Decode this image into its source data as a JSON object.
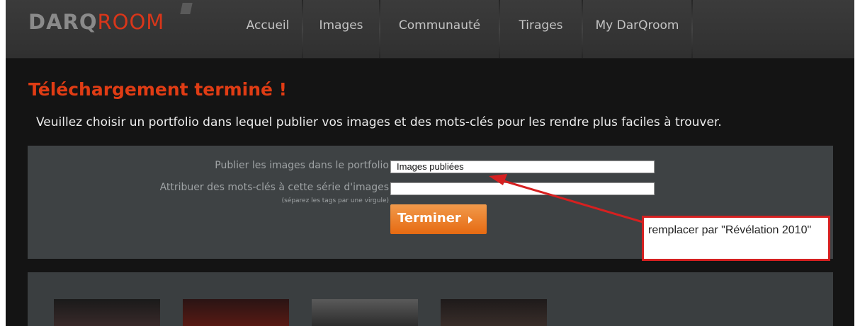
{
  "brand": {
    "part1": "DARQ",
    "part2": "ROOM"
  },
  "nav": {
    "items": [
      {
        "label": "Accueil"
      },
      {
        "label": "Images"
      },
      {
        "label": "Communauté"
      },
      {
        "label": "Tirages"
      },
      {
        "label": "My DarQroom"
      }
    ]
  },
  "page": {
    "title": "Téléchargement terminé !",
    "subtitle": "Veuillez choisir un portfolio dans lequel publier vos images et des mots-clés pour les rendre plus faciles à trouver."
  },
  "form": {
    "portfolio_label": "Publier les images dans le portfolio",
    "portfolio_value": "Images publiées",
    "tags_label": "Attribuer des mots-clés à cette série d'images",
    "tags_hint": "(séparez les tags par une virgule)",
    "tags_value": "",
    "submit_label": "Terminer"
  },
  "annotation": {
    "text": "remplacer par \"Révélation 2010\""
  },
  "colors": {
    "accent": "#e03c14",
    "button": "#e66a12",
    "annotation": "#d62020"
  }
}
